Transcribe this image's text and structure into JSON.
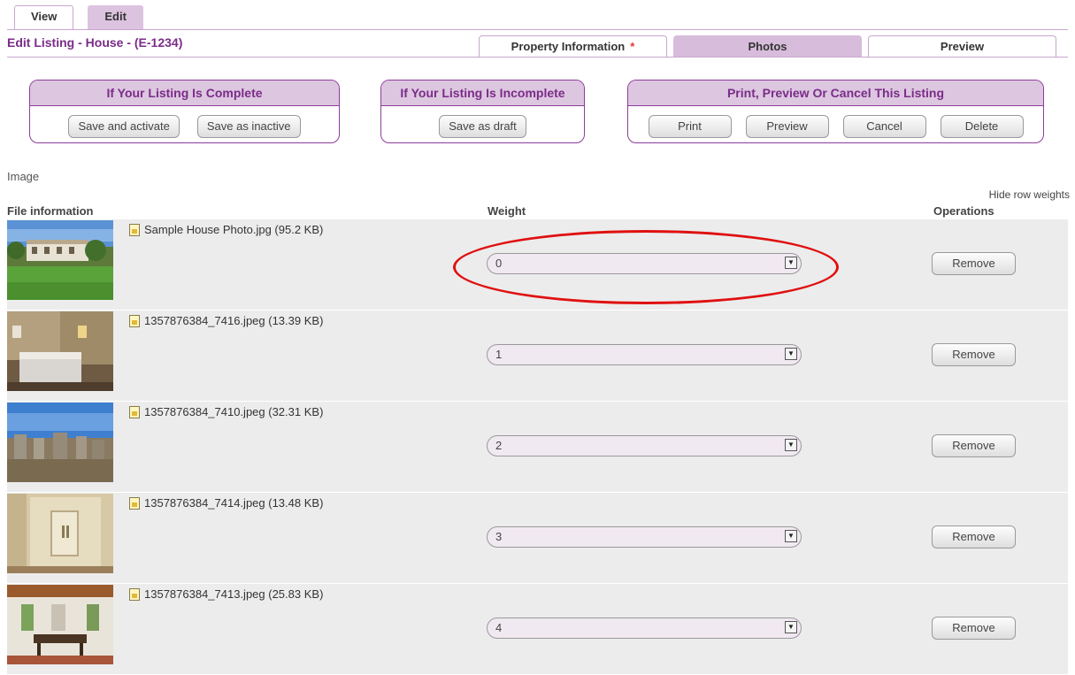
{
  "top_tabs": {
    "view": "View",
    "edit": "Edit"
  },
  "page_title": "Edit Listing - House - (E-1234)",
  "sub_tabs": {
    "property": "Property Information",
    "property_required": "*",
    "photos": "Photos",
    "preview": "Preview"
  },
  "groups": {
    "complete": {
      "title": "If Your Listing Is Complete",
      "save_activate": "Save and activate",
      "save_inactive": "Save as inactive"
    },
    "incomplete": {
      "title": "If Your Listing Is Incomplete",
      "save_draft": "Save as draft"
    },
    "print": {
      "title": "Print, Preview Or Cancel This Listing",
      "print": "Print",
      "preview": "Preview",
      "cancel": "Cancel",
      "delete": "Delete"
    }
  },
  "image_label": "Image",
  "hide_weights": "Hide row weights",
  "columns": {
    "file": "File information",
    "weight": "Weight",
    "operations": "Operations"
  },
  "rows": [
    {
      "file": "Sample House Photo.jpg (95.2 KB)",
      "weight": "0",
      "remove": "Remove"
    },
    {
      "file": "1357876384_7416.jpeg (13.39 KB)",
      "weight": "1",
      "remove": "Remove"
    },
    {
      "file": "1357876384_7410.jpeg (32.31 KB)",
      "weight": "2",
      "remove": "Remove"
    },
    {
      "file": "1357876384_7414.jpeg (13.48 KB)",
      "weight": "3",
      "remove": "Remove"
    },
    {
      "file": "1357876384_7413.jpeg (25.83 KB)",
      "weight": "4",
      "remove": "Remove"
    }
  ],
  "colors": {
    "accent": "#7a2c88",
    "tab_active": "#d7bcdb",
    "row_bg": "#ececec",
    "highlight": "#e01010"
  }
}
